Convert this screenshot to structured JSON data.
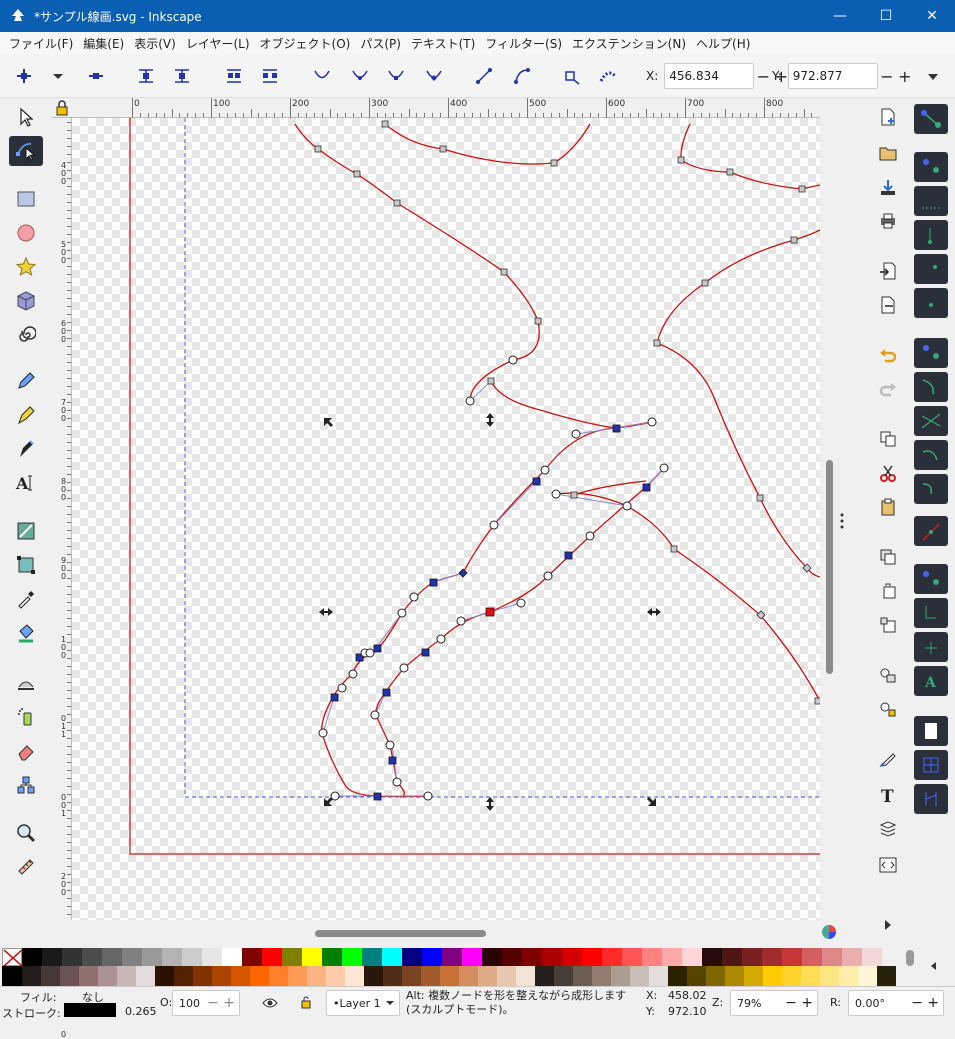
{
  "window": {
    "title": "*サンプル線画.svg - Inkscape",
    "min": "—",
    "max": "☐",
    "close": "✕"
  },
  "menu": [
    "ファイル(F)",
    "編集(E)",
    "表示(V)",
    "レイヤー(L)",
    "オブジェクト(O)",
    "パス(P)",
    "テキスト(T)",
    "フィルター(S)",
    "エクステンション(N)",
    "ヘルプ(H)"
  ],
  "coords": {
    "x_label": "X:",
    "x_value": "456.834",
    "y_label": "Y:",
    "y_value": "972.877",
    "minus": "−",
    "plus": "+"
  },
  "ruler": {
    "h_labels": [
      "0",
      "100",
      "200",
      "300",
      "400",
      "500",
      "600",
      "700",
      "800"
    ],
    "v_labels": [
      "4",
      "0",
      "0",
      "5",
      "0",
      "0",
      "6",
      "0",
      "0",
      "7",
      "0",
      "0",
      "8",
      "0",
      "0",
      "9",
      "0",
      "0",
      "1",
      "0",
      "0",
      "0",
      "1",
      "1",
      "0",
      "0",
      "1",
      "2",
      "0",
      "0",
      "1",
      "3",
      "0",
      "0"
    ]
  },
  "status": {
    "fill_label": "フィル:",
    "fill_value": "なし",
    "stroke_label": "ストローク:",
    "stroke_width": "0.265",
    "opacity_label": "O:",
    "opacity_value": "100",
    "layer": "•Layer 1",
    "message": "Alt: 複数ノードを形を整えながら成形します (スカルプトモード)。",
    "cursor_x_label": "X:",
    "cursor_x": "458.02",
    "cursor_y_label": "Y:",
    "cursor_y": "972.10",
    "zoom_label": "Z:",
    "zoom_value": "79%",
    "rotate_label": "R:",
    "rotate_value": "0.00°"
  },
  "colors": {
    "titlebar": "#0a5fb3",
    "path_stroke": "#cc1111",
    "selected_node": "#2233aa",
    "active_node": "#e01010",
    "page_border": "#cc1111",
    "margin_guide": "#5555cc"
  }
}
